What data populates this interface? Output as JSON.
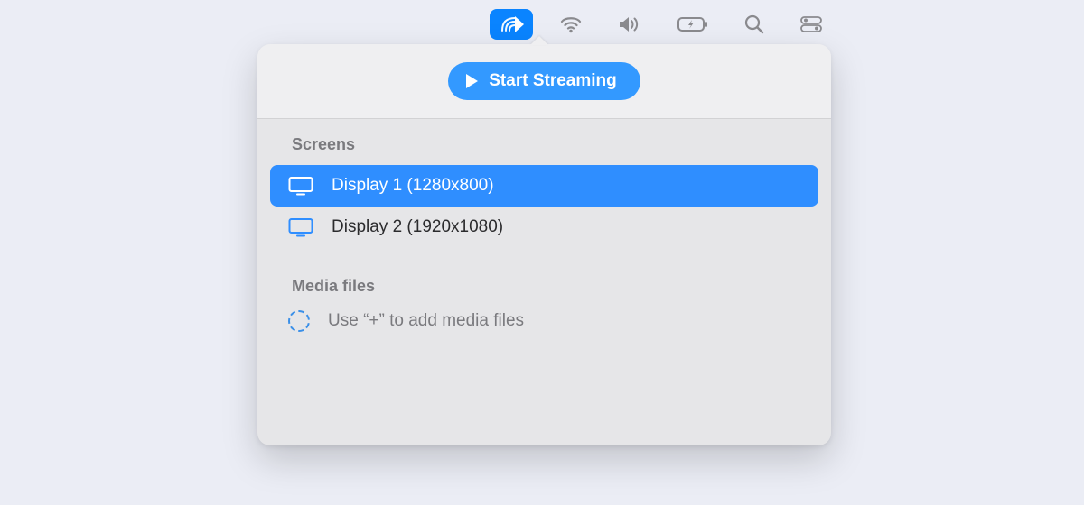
{
  "menubar": {
    "items": [
      {
        "name": "streaming"
      },
      {
        "name": "wifi"
      },
      {
        "name": "volume"
      },
      {
        "name": "battery"
      },
      {
        "name": "search"
      },
      {
        "name": "control-center"
      }
    ]
  },
  "popover": {
    "start_button_label": "Start Streaming",
    "sections": {
      "screens": {
        "title": "Screens",
        "items": [
          {
            "label": "Display 1 (1280x800)",
            "selected": true
          },
          {
            "label": "Display 2 (1920x1080)",
            "selected": false
          }
        ]
      },
      "media_files": {
        "title": "Media files",
        "hint": "Use “+” to add media files"
      }
    }
  },
  "colors": {
    "accent": "#2f8eff",
    "menubar_active": "#0a84ff",
    "bg": "#ebedf5"
  }
}
